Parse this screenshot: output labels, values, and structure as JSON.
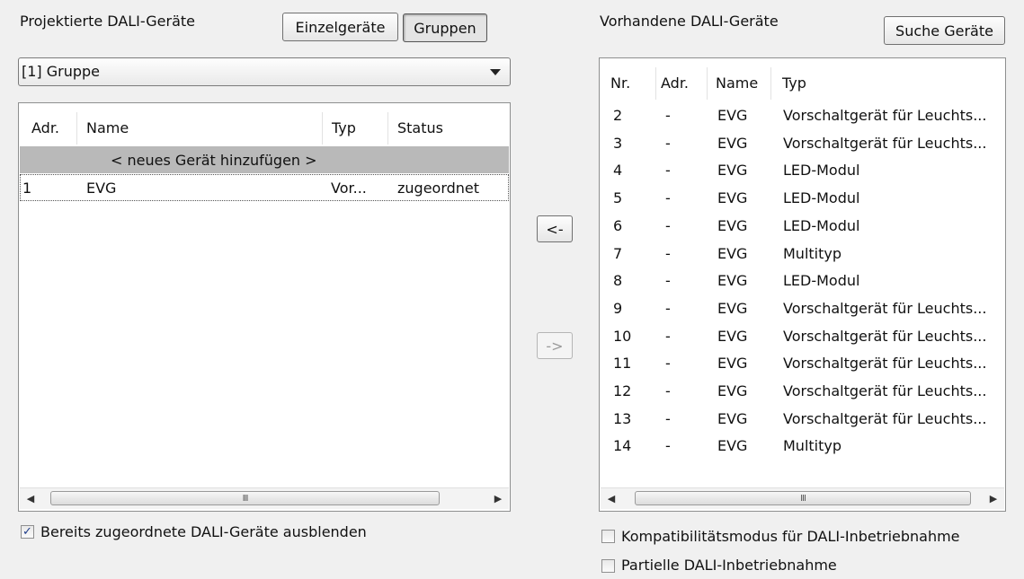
{
  "left": {
    "title": "Projektierte DALI-Geräte",
    "tab_single": "Einzelgeräte",
    "tab_groups": "Gruppen",
    "group_select": "[1] Gruppe",
    "columns": [
      "Adr.",
      "Name",
      "Typ",
      "Status"
    ],
    "add_row": "< neues Gerät hinzufügen >",
    "rows": [
      {
        "adr": "1",
        "name": "EVG",
        "typ": "Vor...",
        "status": "zugeordnet"
      }
    ],
    "scroll_grip": "III",
    "hide_assigned": {
      "label": "Bereits zugeordnete DALI-Geräte ausblenden",
      "checked": true
    }
  },
  "middle": {
    "assign_left": "<-",
    "assign_right": "->"
  },
  "right": {
    "title": "Vorhandene DALI-Geräte",
    "search_button": "Suche Geräte",
    "columns": [
      "Nr.",
      "Adr.",
      "Name",
      "Typ"
    ],
    "rows": [
      {
        "nr": "2",
        "adr": "-",
        "name": "EVG",
        "typ": "Vorschaltgerät für Leuchts..."
      },
      {
        "nr": "3",
        "adr": "-",
        "name": "EVG",
        "typ": "Vorschaltgerät für Leuchts..."
      },
      {
        "nr": "4",
        "adr": "-",
        "name": "EVG",
        "typ": "LED-Modul"
      },
      {
        "nr": "5",
        "adr": "-",
        "name": "EVG",
        "typ": "LED-Modul"
      },
      {
        "nr": "6",
        "adr": "-",
        "name": "EVG",
        "typ": "LED-Modul"
      },
      {
        "nr": "7",
        "adr": "-",
        "name": "EVG",
        "typ": "Multityp"
      },
      {
        "nr": "8",
        "adr": "-",
        "name": "EVG",
        "typ": "LED-Modul"
      },
      {
        "nr": "9",
        "adr": "-",
        "name": "EVG",
        "typ": "Vorschaltgerät für Leuchts..."
      },
      {
        "nr": "10",
        "adr": "-",
        "name": "EVG",
        "typ": "Vorschaltgerät für Leuchts..."
      },
      {
        "nr": "11",
        "adr": "-",
        "name": "EVG",
        "typ": "Vorschaltgerät für Leuchts..."
      },
      {
        "nr": "12",
        "adr": "-",
        "name": "EVG",
        "typ": "Vorschaltgerät für Leuchts..."
      },
      {
        "nr": "13",
        "adr": "-",
        "name": "EVG",
        "typ": "Vorschaltgerät für Leuchts..."
      },
      {
        "nr": "14",
        "adr": "-",
        "name": "EVG",
        "typ": "Multityp"
      }
    ],
    "scroll_grip": "III",
    "compat_mode": {
      "label": "Kompatibilitätsmodus für DALI-Inbetriebnahme",
      "checked": false
    },
    "partial_commissioning": {
      "label": "Partielle DALI-Inbetriebnahme",
      "checked": false
    }
  },
  "colors": {
    "add_row_bg": "#b9b9b9",
    "background": "#f0f0f0",
    "check_mark": "#1f3d8a"
  },
  "icons": {
    "dropdown": "chevron-down-icon",
    "scroll_left": "arrow-left-icon",
    "scroll_right": "arrow-right-icon",
    "check": "check-icon"
  }
}
